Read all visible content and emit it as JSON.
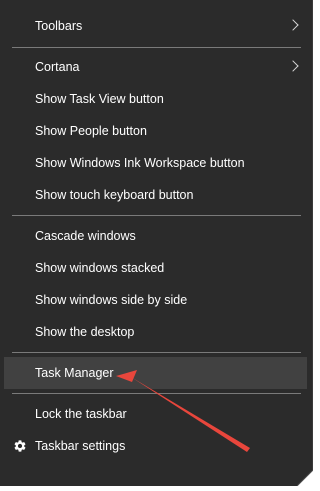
{
  "menu": {
    "toolbars": "Toolbars",
    "cortana": "Cortana",
    "show_task_view": "Show Task View button",
    "show_people": "Show People button",
    "show_ink_workspace": "Show Windows Ink Workspace button",
    "show_touch_keyboard": "Show touch keyboard button",
    "cascade_windows": "Cascade windows",
    "show_stacked": "Show windows stacked",
    "show_side_by_side": "Show windows side by side",
    "show_desktop": "Show the desktop",
    "task_manager": "Task Manager",
    "lock_taskbar": "Lock the taskbar",
    "taskbar_settings": "Taskbar settings"
  },
  "icons": {
    "submenu": "chevron-right-icon",
    "settings": "gear-icon",
    "annotation": "red-arrow"
  },
  "colors": {
    "menu_background": "#2b2b2b",
    "highlight": "#414141",
    "separator": "#7a7a7a",
    "text": "#ffffff",
    "annotation_arrow": "#e8463c"
  }
}
